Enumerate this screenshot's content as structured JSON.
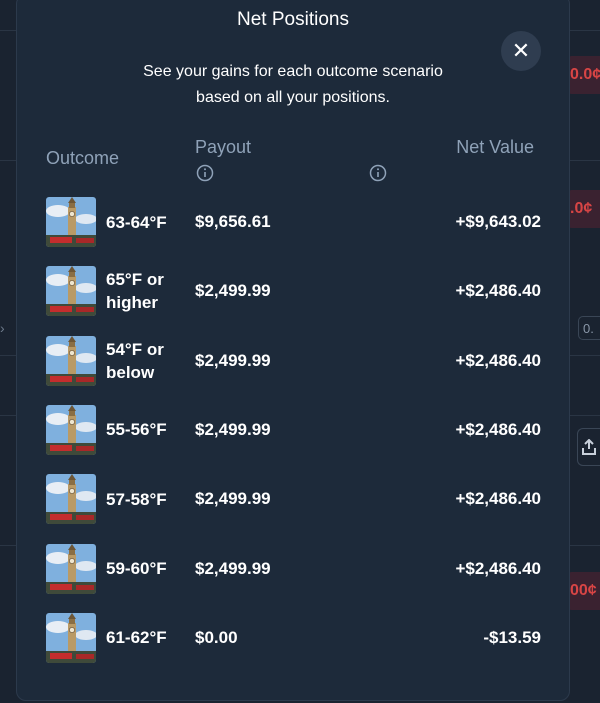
{
  "modal": {
    "title": "Net Positions",
    "subtitle_line1": "See your gains for each outcome scenario",
    "subtitle_line2": "based on all your positions.",
    "close_icon": "close-icon"
  },
  "table": {
    "headers": {
      "outcome": "Outcome",
      "payout": "Payout",
      "net_value": "Net Value"
    },
    "info_icon": "info-icon",
    "rows": [
      {
        "outcome_line1": "63-64°F",
        "outcome_line2": "",
        "payout": "$9,656.61",
        "net_value": "+$9,643.02",
        "thumbnail": "big-ben-thumbnail"
      },
      {
        "outcome_line1": "65°F or",
        "outcome_line2": "higher",
        "payout": "$2,499.99",
        "net_value": "+$2,486.40",
        "thumbnail": "big-ben-thumbnail"
      },
      {
        "outcome_line1": "54°F or",
        "outcome_line2": "below",
        "payout": "$2,499.99",
        "net_value": "+$2,486.40",
        "thumbnail": "big-ben-thumbnail"
      },
      {
        "outcome_line1": "55-56°F",
        "outcome_line2": "",
        "payout": "$2,499.99",
        "net_value": "+$2,486.40",
        "thumbnail": "big-ben-thumbnail"
      },
      {
        "outcome_line1": "57-58°F",
        "outcome_line2": "",
        "payout": "$2,499.99",
        "net_value": "+$2,486.40",
        "thumbnail": "big-ben-thumbnail"
      },
      {
        "outcome_line1": "59-60°F",
        "outcome_line2": "",
        "payout": "$2,499.99",
        "net_value": "+$2,486.40",
        "thumbnail": "big-ben-thumbnail"
      },
      {
        "outcome_line1": "61-62°F",
        "outcome_line2": "",
        "payout": "$0.00",
        "net_value": "-$13.59",
        "thumbnail": "big-ben-thumbnail"
      }
    ]
  },
  "background": {
    "chip1": "0.0¢",
    "chip2": ".0¢",
    "chip3": "00¢",
    "small_value": "0.",
    "colors": {
      "negative": "#d84545",
      "modal_bg": "#1d2a3a",
      "page_bg": "#1a2330"
    }
  }
}
